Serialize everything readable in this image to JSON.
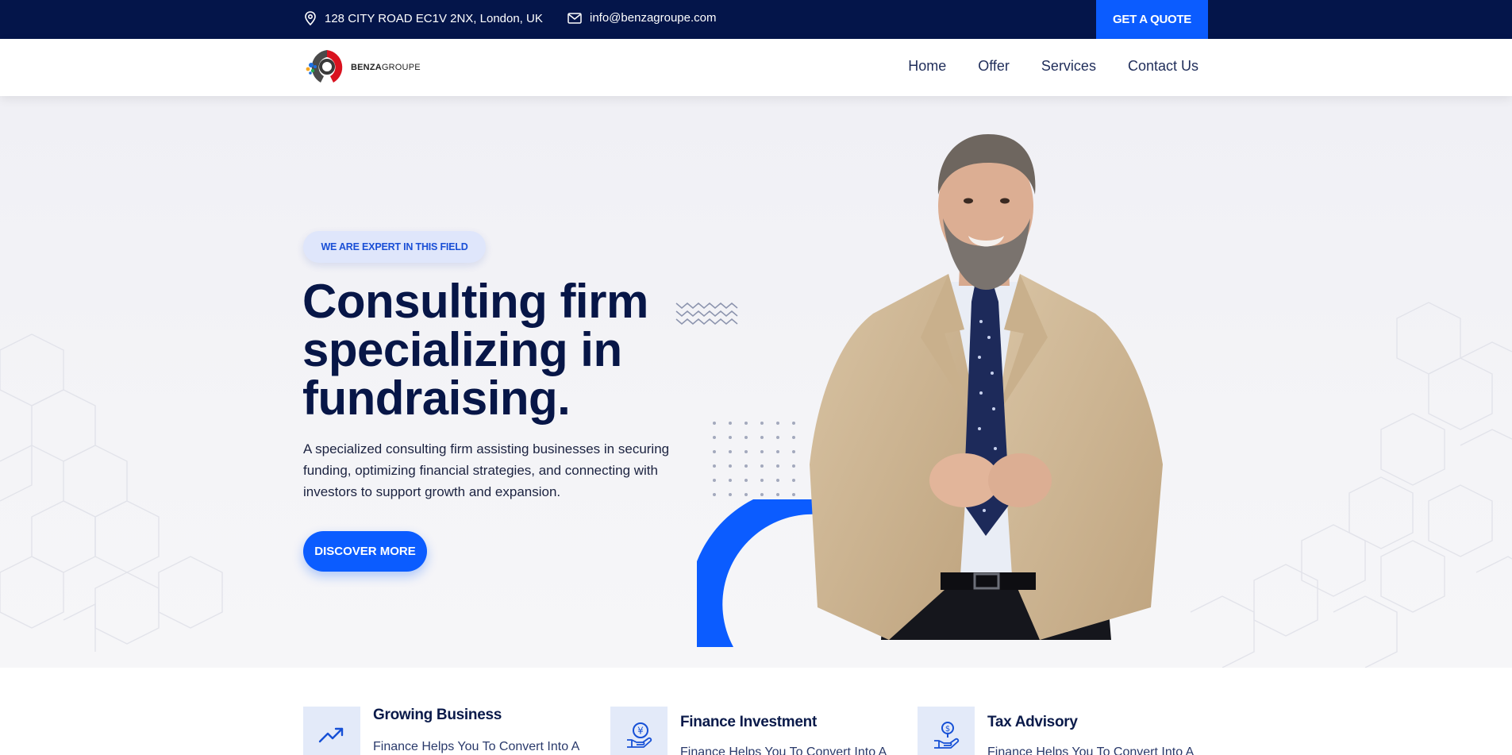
{
  "topbar": {
    "address": "128 CITY ROAD EC1V 2NX, London, UK",
    "email": "info@benzagroupe.com",
    "quote_label": "GET A QUOTE",
    "colors": {
      "background": "#04154a",
      "accent": "#0b5cff"
    }
  },
  "header": {
    "logo": {
      "bold": "BENZA",
      "light": "GROUPE"
    },
    "nav": [
      "Home",
      "Offer",
      "Services",
      "Contact Us"
    ]
  },
  "hero": {
    "badge": "WE ARE EXPERT IN THIS FIELD",
    "title_line1": "Consulting firm",
    "title_line2": "specializing in",
    "title_line3": "fundraising.",
    "description": "A specialized consulting firm assisting businesses in securing funding, optimizing financial strategies, and connecting with investors to support growth and expansion.",
    "cta_label": "DISCOVER MORE"
  },
  "features": [
    {
      "title": "Growing Business",
      "desc": "Finance Helps You To Convert Into A",
      "icon": "trend-up-icon"
    },
    {
      "title": "Finance Investment",
      "desc": "Finance Helps You To Convert Into A",
      "icon": "coin-hand-icon"
    },
    {
      "title": "Tax Advisory",
      "desc": "Finance Helps You To Convert Into A",
      "icon": "dollar-hand-icon"
    }
  ]
}
